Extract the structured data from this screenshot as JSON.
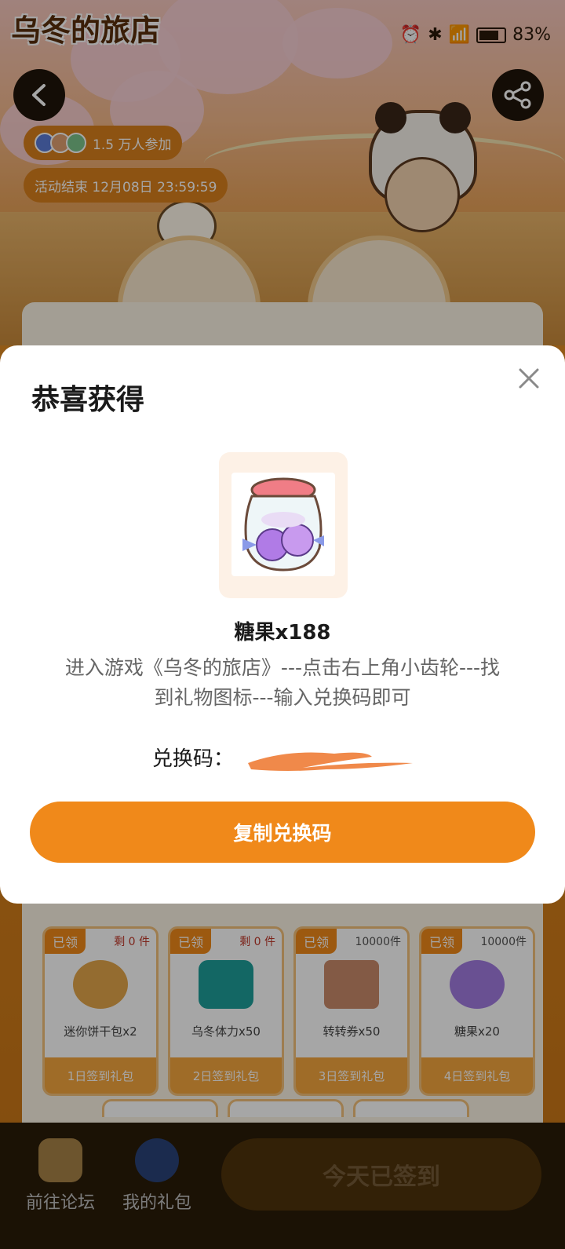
{
  "app": {
    "logo_text": "乌冬的旅店"
  },
  "status_bar": {
    "battery": "83%"
  },
  "header": {
    "participants": "1.5 万人参加",
    "end_time": "活动结束 12月08日 23:59:59"
  },
  "modal": {
    "title": "恭喜获得",
    "item_name": "糖果x188",
    "instructions": "进入游戏《乌冬的旅店》---点击右上角小齿轮---找到礼物图标---输入兑换码即可",
    "code_label": "兑换码：",
    "copy_button": "复制兑换码"
  },
  "gifts": [
    {
      "badge": "已领",
      "stock": "剩 0 件",
      "name": "迷你饼干包x2",
      "day": "1日签到礼包"
    },
    {
      "badge": "已领",
      "stock": "剩 0 件",
      "name": "乌冬体力x50",
      "day": "2日签到礼包"
    },
    {
      "badge": "已领",
      "stock": "10000件",
      "name": "转转券x50",
      "day": "3日签到礼包"
    },
    {
      "badge": "已领",
      "stock": "10000件",
      "name": "糖果x20",
      "day": "4日签到礼包"
    }
  ],
  "bottom_nav": {
    "forum": "前往论坛",
    "my_gifts": "我的礼包",
    "signed_today": "今天已签到"
  },
  "colors": {
    "accent": "#f0891a",
    "redaction": "#f0894a"
  }
}
